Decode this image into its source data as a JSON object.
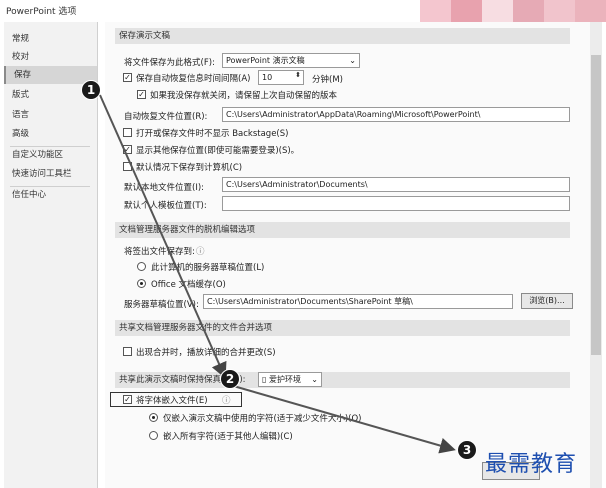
{
  "window": {
    "title": "PowerPoint 选项"
  },
  "watermark_colors": [
    "#f4c6cf",
    "#e8a2ae",
    "#f7dde2",
    "#e6aab5",
    "#f1c4cc",
    "#ebb3bc"
  ],
  "sidebar": {
    "items": [
      {
        "label": "常规"
      },
      {
        "label": "校对"
      },
      {
        "label": "保存",
        "selected": true
      },
      {
        "label": "版式"
      },
      {
        "label": "语言"
      },
      {
        "label": "高级"
      },
      {
        "label": "自定义功能区"
      },
      {
        "label": "快速访问工具栏"
      },
      {
        "label": "信任中心"
      }
    ]
  },
  "save_section": {
    "header": "保存演示文稿",
    "format_label": "将文件保存为此格式(F):",
    "format_value": "PowerPoint 演示文稿",
    "autorecover_label": "保存自动恢复信息时间间隔(A)",
    "autorecover_minutes": "10",
    "minutes_label": "分钟(M)",
    "keep_last_label": "如果我没保存就关闭，请保留上次自动保留的版本",
    "autorecover_location_label": "自动恢复文件位置(R):",
    "autorecover_location_value": "C:\\Users\\Administrator\\AppData\\Roaming\\Microsoft\\PowerPoint\\",
    "no_backstage_label": "打开或保存文件时不显示 Backstage(S)",
    "show_extra_label": "显示其他保存位置(即使可能需要登录)(S)。",
    "default_local_label": "默认情况下保存到计算机(C)",
    "default_local_location_label": "默认本地文件位置(I):",
    "default_local_location_value": "C:\\Users\\Administrator\\Documents\\",
    "personal_templates_label": "默认个人模板位置(T):",
    "personal_templates_value": ""
  },
  "offline_section": {
    "header": "文档管理服务器文件的脱机编辑选项",
    "save_to_label": "将签出文件保存到:",
    "server_drafts_label": "此计算机的服务器草稿位置(L)",
    "office_cache_label": "Office 文档缓存(O)",
    "drafts_location_label": "服务器草稿位置(V):",
    "drafts_location_value": "C:\\Users\\Administrator\\Documents\\SharePoint 草稿\\",
    "browse_label": "浏览(B)..."
  },
  "merge_section": {
    "header": "共享文档管理服务器文件的文件合并选项",
    "show_merge_label": "出现合并时，播放详细的合并更改(S)"
  },
  "fidelity_section": {
    "header": "共享此演示文稿时保持保真度(D):",
    "presentation_value": "爱护环境",
    "embed_fonts_label": "将字体嵌入文件(E)",
    "embed_used_label": "仅嵌入演示文稿中使用的字符(适于减少文件大小)(O)",
    "embed_all_label": "嵌入所有字符(适于其他人编辑)(C)"
  },
  "steps": [
    "1",
    "2",
    "3"
  ],
  "brand_text": "最需教育"
}
